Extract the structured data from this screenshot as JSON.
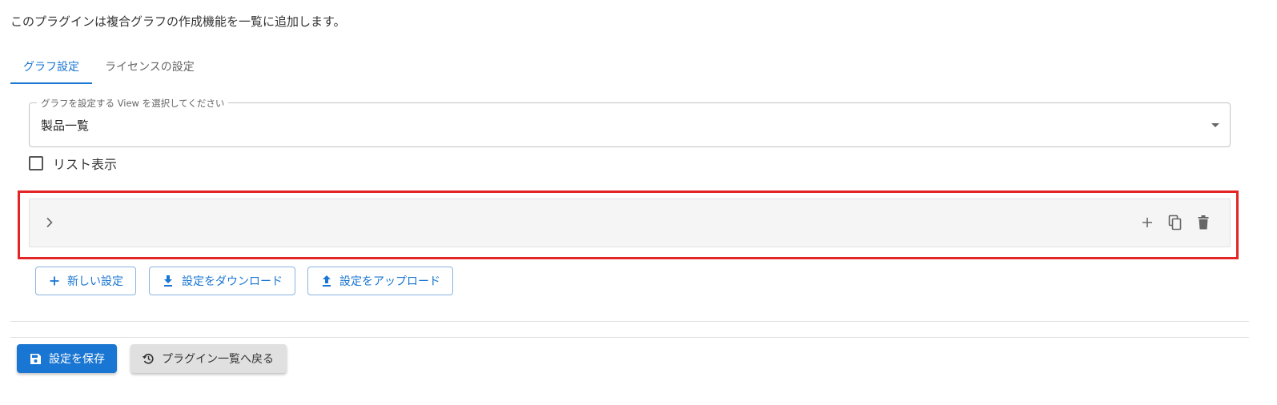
{
  "description": "このプラグインは複合グラフの作成機能を一覧に追加します。",
  "tabs": [
    {
      "label": "グラフ設定",
      "active": true
    },
    {
      "label": "ライセンスの設定",
      "active": false
    }
  ],
  "view_select": {
    "label": "グラフを設定する View を選択してください",
    "value": "製品一覧"
  },
  "list_display": {
    "label": "リスト表示",
    "checked": false
  },
  "accordion": {
    "expand_icon": "chevron-right-icon",
    "action_icons": [
      "add-icon",
      "copy-icon",
      "delete-icon"
    ]
  },
  "actions": {
    "new_setting": "新しい設定",
    "download": "設定をダウンロード",
    "upload": "設定をアップロード"
  },
  "footer": {
    "save": "設定を保存",
    "back": "プラグイン一覧へ戻る"
  },
  "colors": {
    "primary": "#1976d2",
    "highlight": "#e32525",
    "accordion_bg": "#f5f5f5",
    "secondary_button_bg": "#e0e0e0"
  }
}
